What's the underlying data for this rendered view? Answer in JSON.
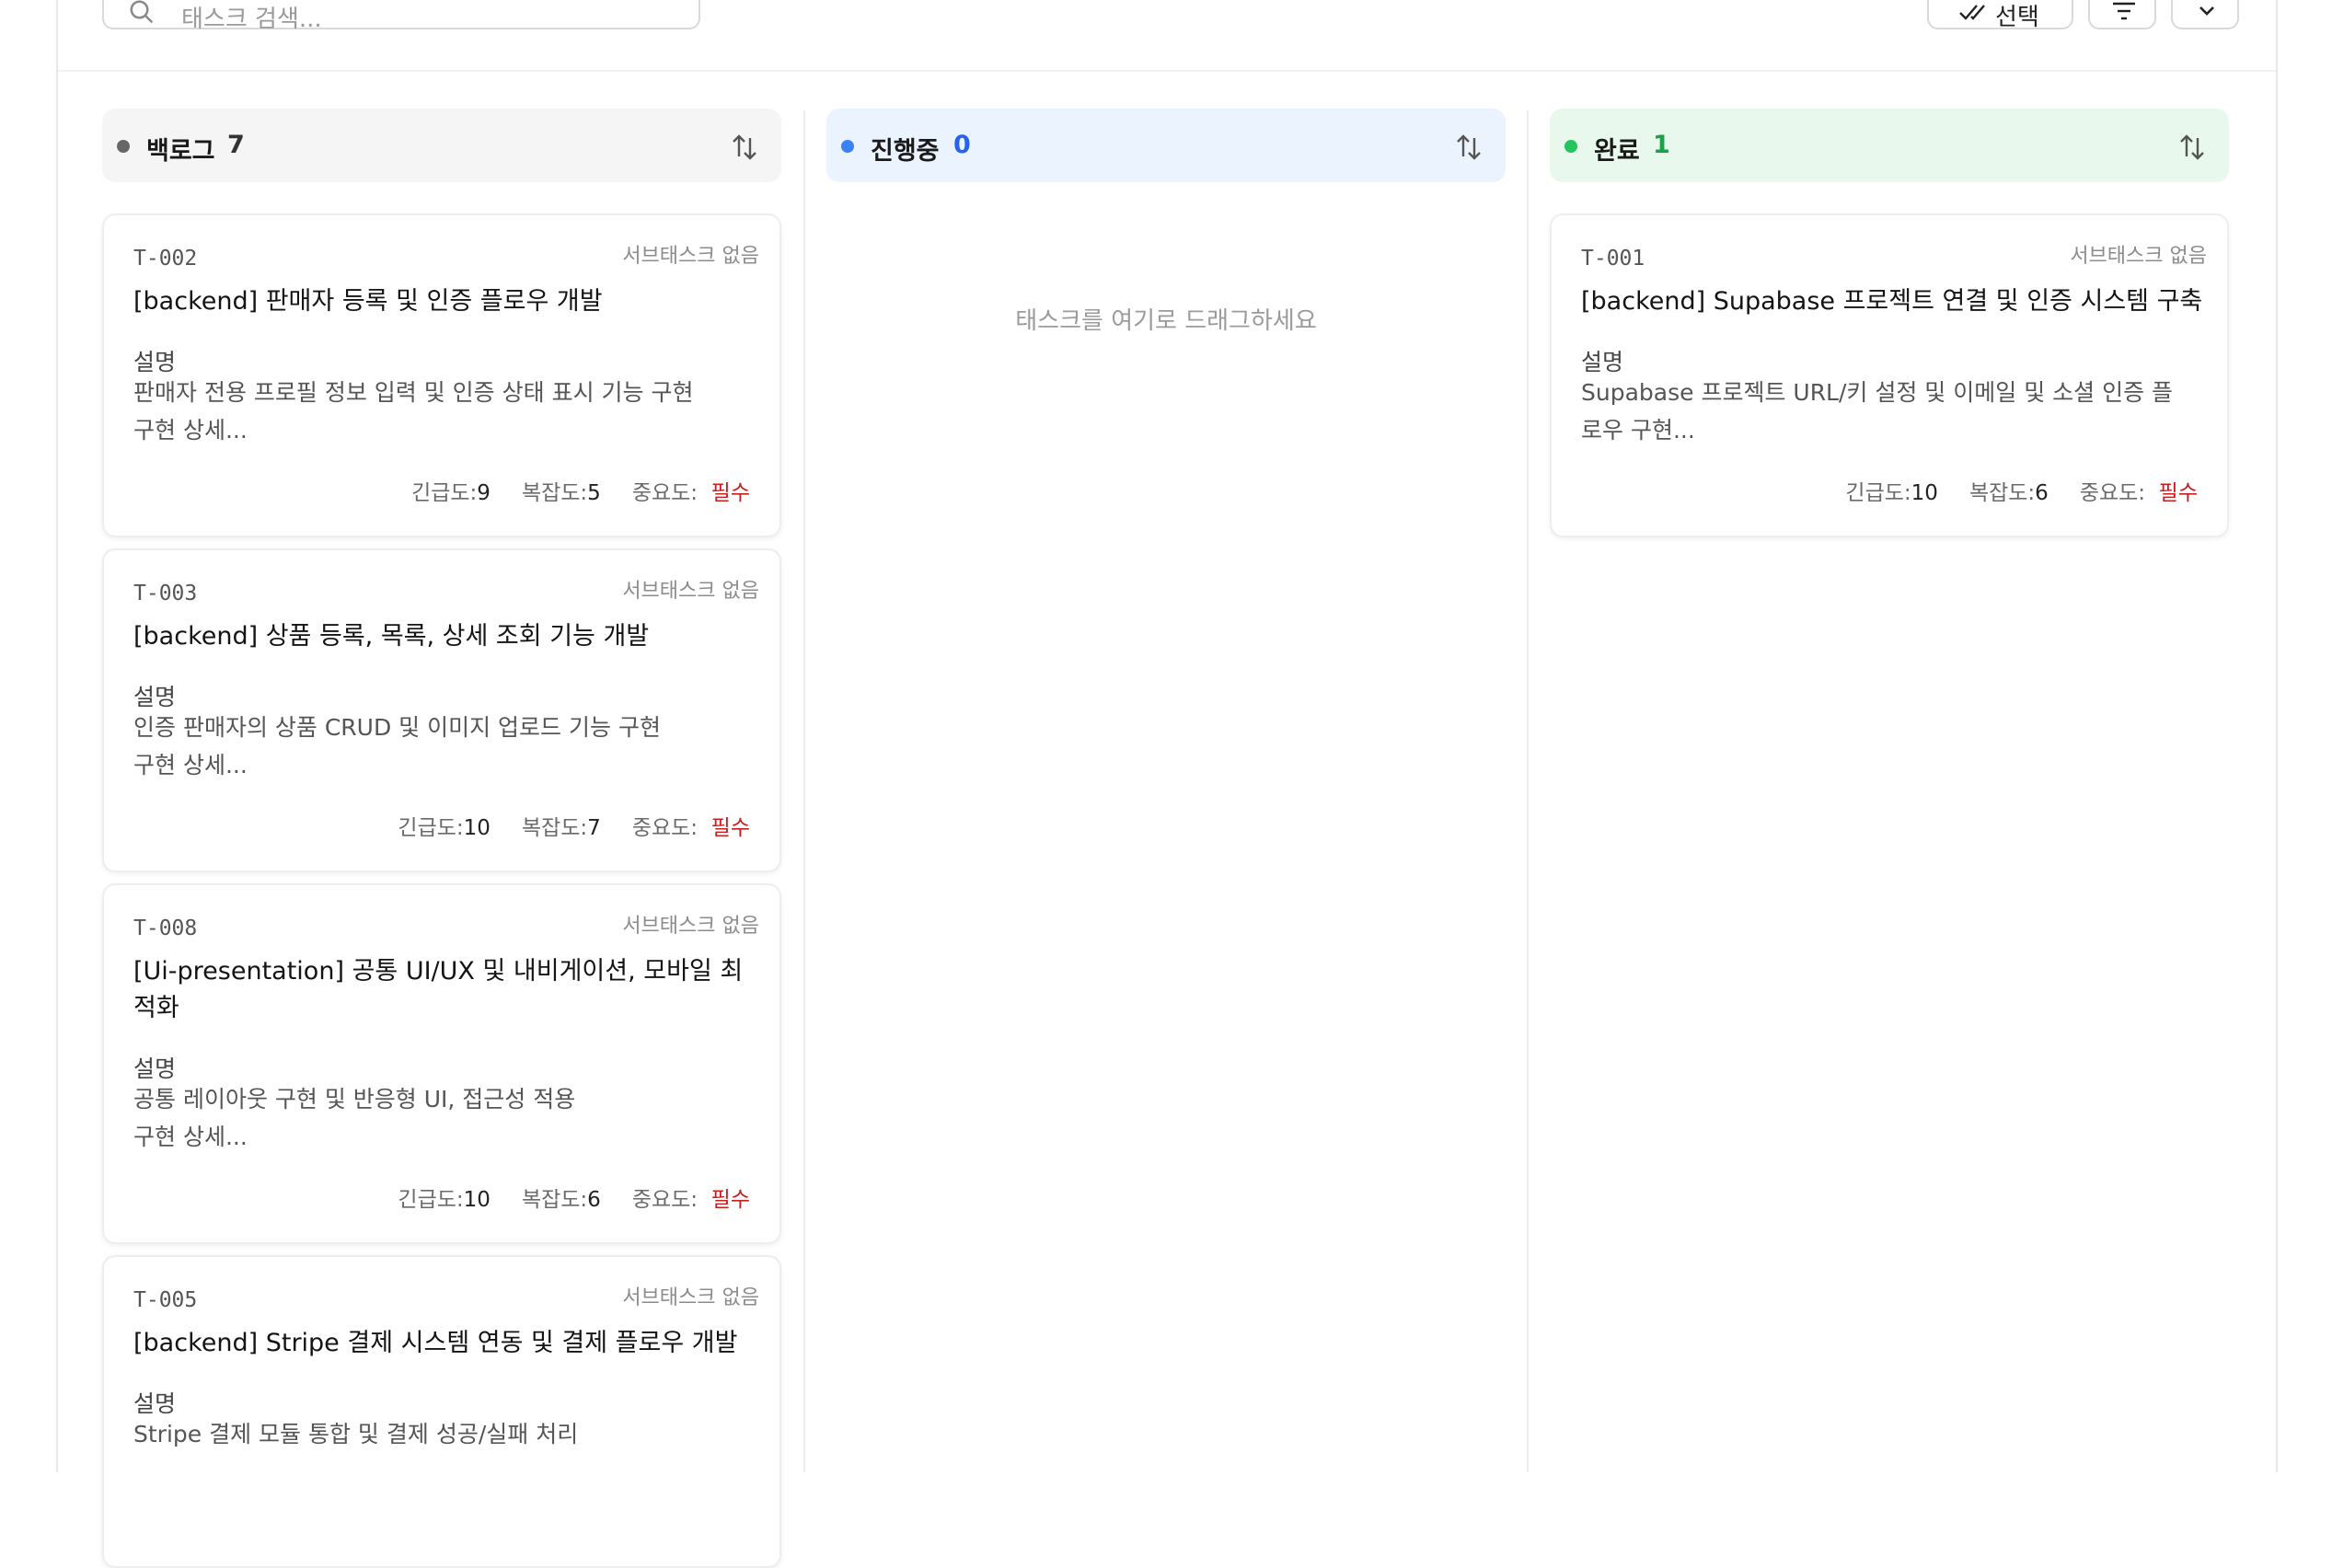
{
  "search": {
    "placeholder": "태스크 검색..."
  },
  "toolbar": {
    "select_label": "선택"
  },
  "columns": [
    {
      "name": "백로그",
      "count": "7",
      "dot_color": "#666666",
      "head_bg": "#f5f5f5",
      "count_color": "#333333",
      "cards": [
        {
          "id": "T-002",
          "subtasks": "서브태스크 없음",
          "title": "[backend] 판매자 등록 및 인증 플로우 개발",
          "desc_label": "설명",
          "desc_line1": "판매자 전용 프로필 정보 입력 및 인증 상태 표시 기능 구현",
          "desc_line2": "구현 상세...",
          "urgency_label": "긴급도:",
          "urgency": "9",
          "complexity_label": "복잡도:",
          "complexity": "5",
          "importance_label": "중요도:",
          "importance": "필수"
        },
        {
          "id": "T-003",
          "subtasks": "서브태스크 없음",
          "title": "[backend] 상품 등록, 목록, 상세 조회 기능 개발",
          "desc_label": "설명",
          "desc_line1": "인증 판매자의 상품 CRUD 및 이미지 업로드 기능 구현",
          "desc_line2": "구현 상세...",
          "urgency_label": "긴급도:",
          "urgency": "10",
          "complexity_label": "복잡도:",
          "complexity": "7",
          "importance_label": "중요도:",
          "importance": "필수"
        },
        {
          "id": "T-008",
          "subtasks": "서브태스크 없음",
          "title": "[Ui-presentation] 공통 UI/UX 및 내비게이션, 모바일 최적화",
          "desc_label": "설명",
          "desc_line1": "공통 레이아웃 구현 및 반응형 UI, 접근성 적용",
          "desc_line2": "구현 상세...",
          "urgency_label": "긴급도:",
          "urgency": "10",
          "complexity_label": "복잡도:",
          "complexity": "6",
          "importance_label": "중요도:",
          "importance": "필수"
        },
        {
          "id": "T-005",
          "subtasks": "서브태스크 없음",
          "title": "[backend] Stripe 결제 시스템 연동 및 결제 플로우 개발",
          "desc_label": "설명",
          "desc_line1": "Stripe 결제 모듈 통합 및 결제 성공/실패 처리",
          "desc_line2": ""
        }
      ]
    },
    {
      "name": "진행중",
      "count": "0",
      "dot_color": "#3b82f6",
      "head_bg": "#eaf3fe",
      "count_color": "#2563eb",
      "empty_hint": "태스크를 여기로 드래그하세요"
    },
    {
      "name": "완료",
      "count": "1",
      "dot_color": "#22c55e",
      "head_bg": "#e9f8ed",
      "count_color": "#16a34a",
      "cards": [
        {
          "id": "T-001",
          "subtasks": "서브태스크 없음",
          "title": "[backend] Supabase 프로젝트 연결 및 인증 시스템 구축",
          "desc_label": "설명",
          "desc_line1": "Supabase 프로젝트 URL/키 설정 및 이메일 및 소셜 인증 플",
          "desc_line2": "로우 구현...",
          "urgency_label": "긴급도:",
          "urgency": "10",
          "complexity_label": "복잡도:",
          "complexity": "6",
          "importance_label": "중요도:",
          "importance": "필수"
        }
      ]
    }
  ]
}
